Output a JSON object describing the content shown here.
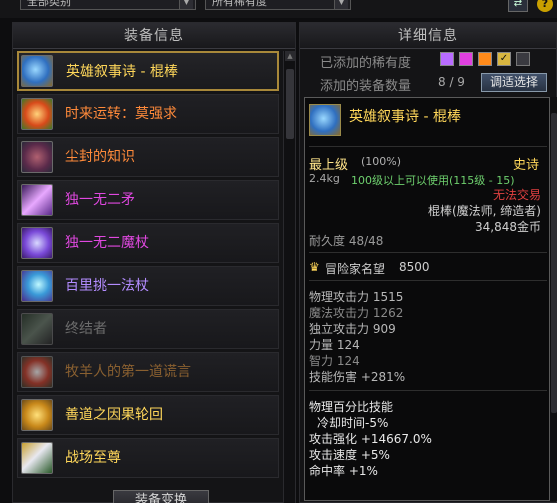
{
  "filters": {
    "category": "全部类别",
    "rarity": "所有稀有度"
  },
  "left_panel": {
    "title": "装备信息",
    "items": [
      {
        "label": "英雄叙事诗 - 棍棒",
        "color": "#ffd75a",
        "icon": "blue-mask-icon"
      },
      {
        "label": "时来运转：莫强求",
        "color": "#ff8a3a",
        "icon": "fortune-gear-icon"
      },
      {
        "label": "尘封的知识",
        "color": "#ff8a3a",
        "icon": "dusty-book-icon"
      },
      {
        "label": "独一无二矛",
        "color": "#e048e0",
        "icon": "purple-spear-icon"
      },
      {
        "label": "独一无二魔杖",
        "color": "#e048e0",
        "icon": "purple-wand-icon"
      },
      {
        "label": "百里挑一法杖",
        "color": "#b38cff",
        "icon": "staff-orb-icon"
      },
      {
        "label": "终结者",
        "color": "#6c6c6c",
        "icon": "terminator-icon"
      },
      {
        "label": "牧羊人的第一道谎言",
        "color": "#8a6030",
        "icon": "shepherd-icon"
      },
      {
        "label": "善道之因果轮回",
        "color": "#ffd75a",
        "icon": "karma-wheel-icon"
      },
      {
        "label": "战场至尊",
        "color": "#ffd75a",
        "icon": "battlefield-icon"
      }
    ],
    "button": "装备变换"
  },
  "right_panel": {
    "title": "详细信息",
    "added_rarity_label": "已添加的稀有度",
    "rarity_swatches": [
      "#b86cff",
      "#e040e0",
      "#ff8a1a",
      "#d8b640"
    ],
    "added_count_label": "添加的装备数量",
    "added_count": "8 / 9",
    "select_button": "调适选择"
  },
  "tooltip": {
    "name": "英雄叙事诗 - 棍棒",
    "grade": "最上级",
    "grade_pct": "(100%)",
    "rarity_text": "史诗",
    "weight": "2.4kg",
    "level_req": "100级以上可以使用(115级 - 15)",
    "trade": "无法交易",
    "type": "棍棒(魔法师, 缔造者)",
    "price": "34,848金币",
    "durability": "耐久度 48/48",
    "adventure_fame": "冒险家名望",
    "adventure_fame_value": "8500",
    "stats": [
      "物理攻击力 1515",
      "魔法攻击力 1262",
      "独立攻击力 909",
      "力量 124",
      "智力 124",
      "技能伤害 +281%"
    ],
    "skill_header": "物理百分比技能",
    "skill_stats": [
      "冷却时间-5%",
      "攻击强化 +14667.0%",
      "攻击速度 +5%",
      "命中率 +1%"
    ]
  }
}
